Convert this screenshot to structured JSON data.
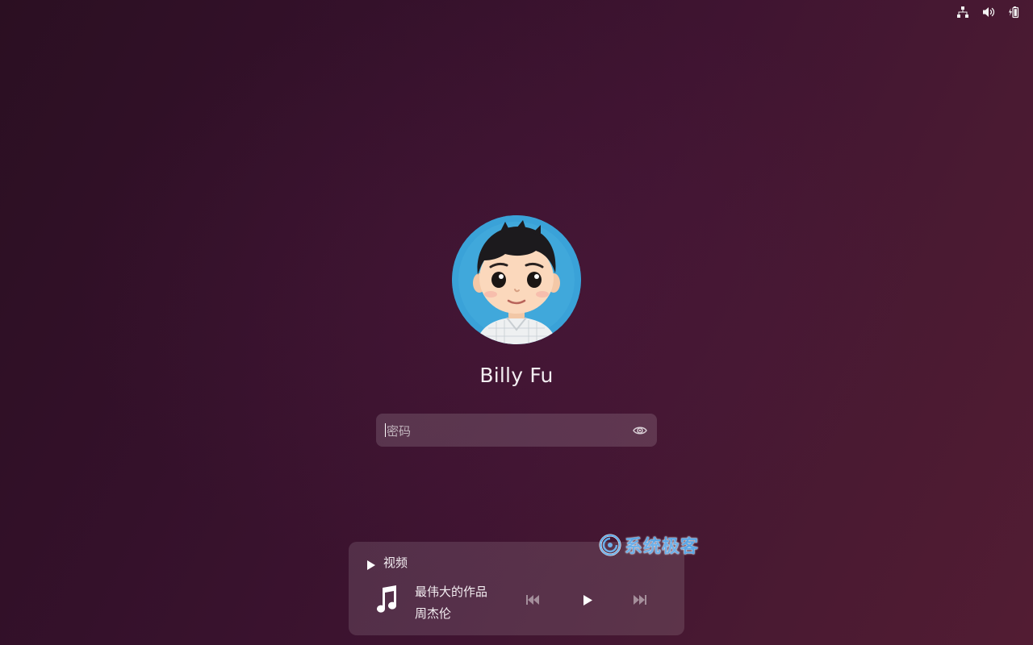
{
  "system_tray": {
    "icons": [
      "network-icon",
      "volume-icon",
      "battery-icon"
    ]
  },
  "login": {
    "username": "Billy Fu",
    "password_placeholder": "密码"
  },
  "media_player": {
    "section_label": "视频",
    "track_title": "最伟大的作品",
    "track_artist": "周杰伦",
    "state": "paused"
  },
  "watermark": {
    "text": "系统极客"
  },
  "colors": {
    "background_start": "#2b0f22",
    "background_end": "#521c33",
    "watermark": "#5aa6e6",
    "avatar_background": "#3aa2d8"
  }
}
